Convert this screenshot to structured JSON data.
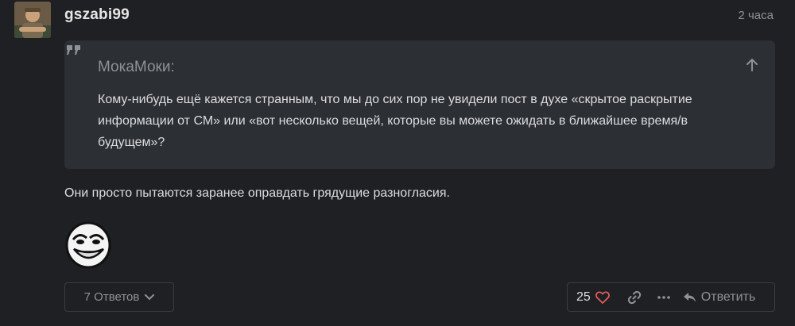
{
  "post": {
    "username": "gszabi99",
    "time": "2 часа",
    "quote": {
      "author": "МокаМоки:",
      "text": "Кому-нибудь ещё кажется странным, что мы до сих пор не увидели пост в духе «скрытое раскрытие информации от СМ» или «вот несколько вещей, которые вы можете ожидать в ближайшее время/в будущем»?"
    },
    "body": "Они просто пытаются заранее оправдать грядущие разногласия."
  },
  "footer": {
    "replies_label": "7 Ответов",
    "like_count": "25",
    "reply_label": "Ответить"
  },
  "colors": {
    "background": "#1f2023",
    "quote_background": "#2c2f33",
    "like_heart": "#e45b5b",
    "muted_text": "#8e9297"
  }
}
